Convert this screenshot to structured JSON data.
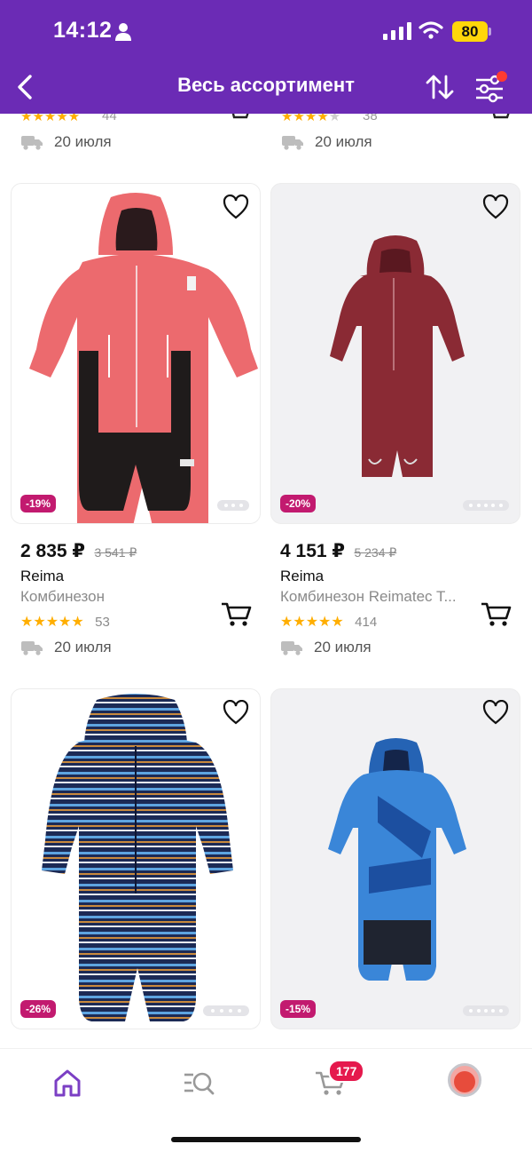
{
  "status_bar": {
    "time": "14:12",
    "battery": "80"
  },
  "header": {
    "title": "Весь ассортимент"
  },
  "partial_row": [
    {
      "rating_count": "44",
      "delivery": "20 июля"
    },
    {
      "rating_count": "38",
      "delivery": "20 июля"
    }
  ],
  "products": [
    {
      "discount": "-19%",
      "price": "2 835 ₽",
      "old_price": "3 541 ₽",
      "brand": "Reima",
      "name": "Комбинезон",
      "stars": "★★★★★",
      "rating_count": "53",
      "delivery": "20 июля",
      "image": "pink-black-snowsuit"
    },
    {
      "discount": "-20%",
      "price": "4 151 ₽",
      "old_price": "5 234 ₽",
      "brand": "Reima",
      "name": "Комбинезон Reimatec T...",
      "stars": "★★★★★",
      "rating_count": "414",
      "delivery": "20 июля",
      "image": "burgundy-snowsuit"
    },
    {
      "discount": "-26%",
      "image": "navy-striped-snowsuit"
    },
    {
      "discount": "-15%",
      "image": "blue-print-snowsuit"
    }
  ],
  "tabbar": {
    "cart_count": "177",
    "items": [
      "home-icon",
      "catalog-search-icon",
      "cart-icon",
      "profile-avatar"
    ]
  },
  "colors": {
    "accent": "#6b2bb5",
    "discount_badge": "#c21a6f",
    "stars": "#ffae00",
    "cart_badge": "#e5194d"
  }
}
